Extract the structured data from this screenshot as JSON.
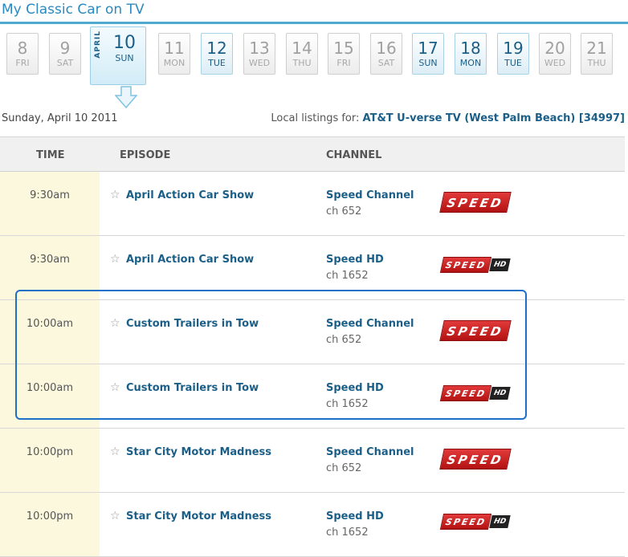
{
  "page_title": "My Classic Car on TV",
  "calendar": {
    "month": "APRIL",
    "days": [
      {
        "num": "8",
        "dow": "FRI",
        "has_listing": false
      },
      {
        "num": "9",
        "dow": "SAT",
        "has_listing": false
      },
      {
        "num": "10",
        "dow": "SUN",
        "has_listing": true,
        "selected": true
      },
      {
        "num": "11",
        "dow": "MON",
        "has_listing": false
      },
      {
        "num": "12",
        "dow": "TUE",
        "has_listing": true
      },
      {
        "num": "13",
        "dow": "WED",
        "has_listing": false
      },
      {
        "num": "14",
        "dow": "THU",
        "has_listing": false
      },
      {
        "num": "15",
        "dow": "FRI",
        "has_listing": false
      },
      {
        "num": "16",
        "dow": "SAT",
        "has_listing": false
      },
      {
        "num": "17",
        "dow": "SUN",
        "has_listing": true
      },
      {
        "num": "18",
        "dow": "MON",
        "has_listing": true
      },
      {
        "num": "19",
        "dow": "TUE",
        "has_listing": true
      },
      {
        "num": "20",
        "dow": "WED",
        "has_listing": false
      },
      {
        "num": "21",
        "dow": "THU",
        "has_listing": false
      }
    ]
  },
  "selected_date": "Sunday, April 10 2011",
  "local_listings": {
    "label": "Local listings for:",
    "provider": "AT&T U-verse TV (West Palm Beach) [34997]"
  },
  "table": {
    "headers": {
      "time": "TIME",
      "episode": "EPISODE",
      "channel": "CHANNEL"
    },
    "rows": [
      {
        "time": "9:30am",
        "episode": "April Action Car Show",
        "channel": "Speed Channel",
        "ch": "ch 652",
        "logo": "SPEED"
      },
      {
        "time": "9:30am",
        "episode": "April Action Car Show",
        "channel": "Speed HD",
        "ch": "ch 1652",
        "logo": "SPEED",
        "logo_hd": "HD"
      },
      {
        "time": "10:00am",
        "episode": "Custom Trailers in Tow",
        "channel": "Speed Channel",
        "ch": "ch 652",
        "logo": "SPEED"
      },
      {
        "time": "10:00am",
        "episode": "Custom Trailers in Tow",
        "channel": "Speed HD",
        "ch": "ch 1652",
        "logo": "SPEED",
        "logo_hd": "HD"
      },
      {
        "time": "10:00pm",
        "episode": "Star City Motor Madness",
        "channel": "Speed Channel",
        "ch": "ch 652",
        "logo": "SPEED"
      },
      {
        "time": "10:00pm",
        "episode": "Star City Motor Madness",
        "channel": "Speed HD",
        "ch": "ch 1652",
        "logo": "SPEED",
        "logo_hd": "HD"
      }
    ]
  },
  "colors": {
    "accent": "#2a8ac0",
    "link": "#1b5f88",
    "time_column_bg": "#fbf8de",
    "highlight_border": "#1e6fc8",
    "speed_red": "#c41a1a"
  }
}
